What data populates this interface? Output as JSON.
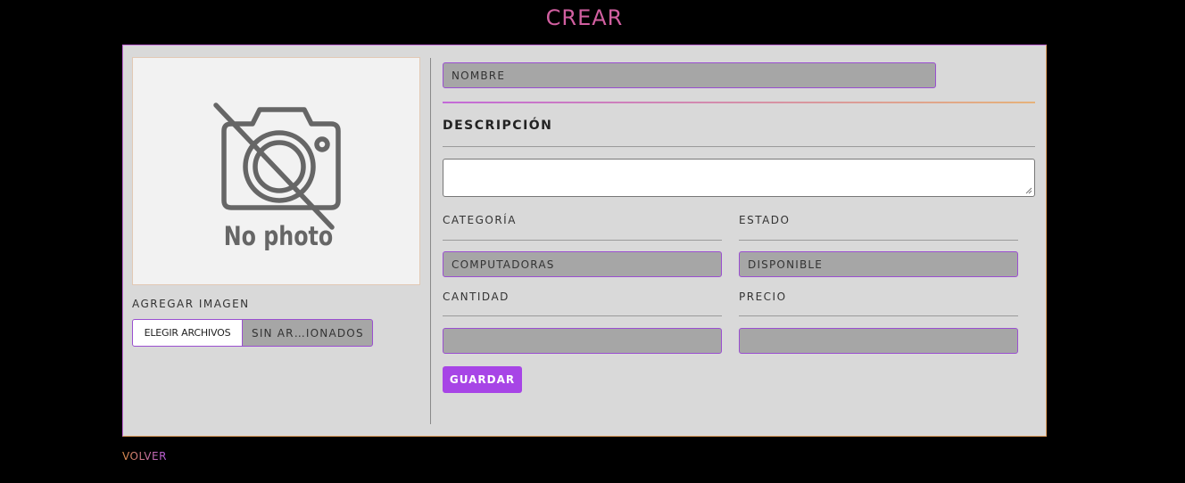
{
  "page": {
    "title": "CREAR",
    "back_link": "VOLVER"
  },
  "image_panel": {
    "placeholder_text": "No photo",
    "add_image_label": "AGREGAR IMAGEN",
    "choose_files_button": "ELEGIR ARCHIVOS",
    "file_status": "SIN AR…IONADOS"
  },
  "form": {
    "name_placeholder": "NOMBRE",
    "name_value": "",
    "description_label": "DESCRIPCIÓN",
    "description_value": "",
    "category_label": "CATEGORÍA",
    "category_value": "COMPUTADORAS",
    "status_label": "ESTADO",
    "status_value": "DISPONIBLE",
    "quantity_label": "CANTIDAD",
    "quantity_value": "",
    "price_label": "PRECIO",
    "price_value": "",
    "save_button": "GUARDAR"
  },
  "colors": {
    "background": "#000000",
    "card": "#d9d9d9",
    "title": "#d15fa0",
    "accent_purple": "#a745e6",
    "field_bg": "#a6a6a6",
    "field_border": "#9a4fd0"
  },
  "icons": {
    "photo_placeholder": "no-photo-camera-icon"
  }
}
